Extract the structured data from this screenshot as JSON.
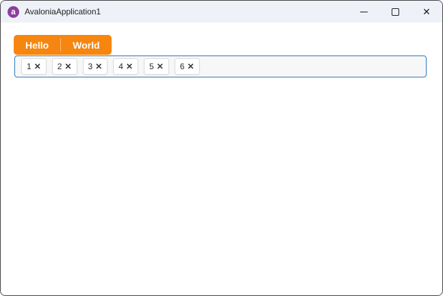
{
  "titlebar": {
    "title": "AvaloniaApplication1",
    "app_icon_glyph": "a",
    "close_glyph": "✕"
  },
  "toolbar": {
    "split_button": {
      "primary_label": "Hello",
      "secondary_label": "World"
    }
  },
  "tag_box": {
    "remove_glyph": "✕",
    "chips": [
      "1",
      "2",
      "3",
      "4",
      "5",
      "6"
    ]
  },
  "colors": {
    "accent_orange": "#F6860F",
    "tag_box_border": "#2878BE",
    "titlebar_bg": "#EEF2F8",
    "app_icon_purple": "#8C3F9E"
  }
}
